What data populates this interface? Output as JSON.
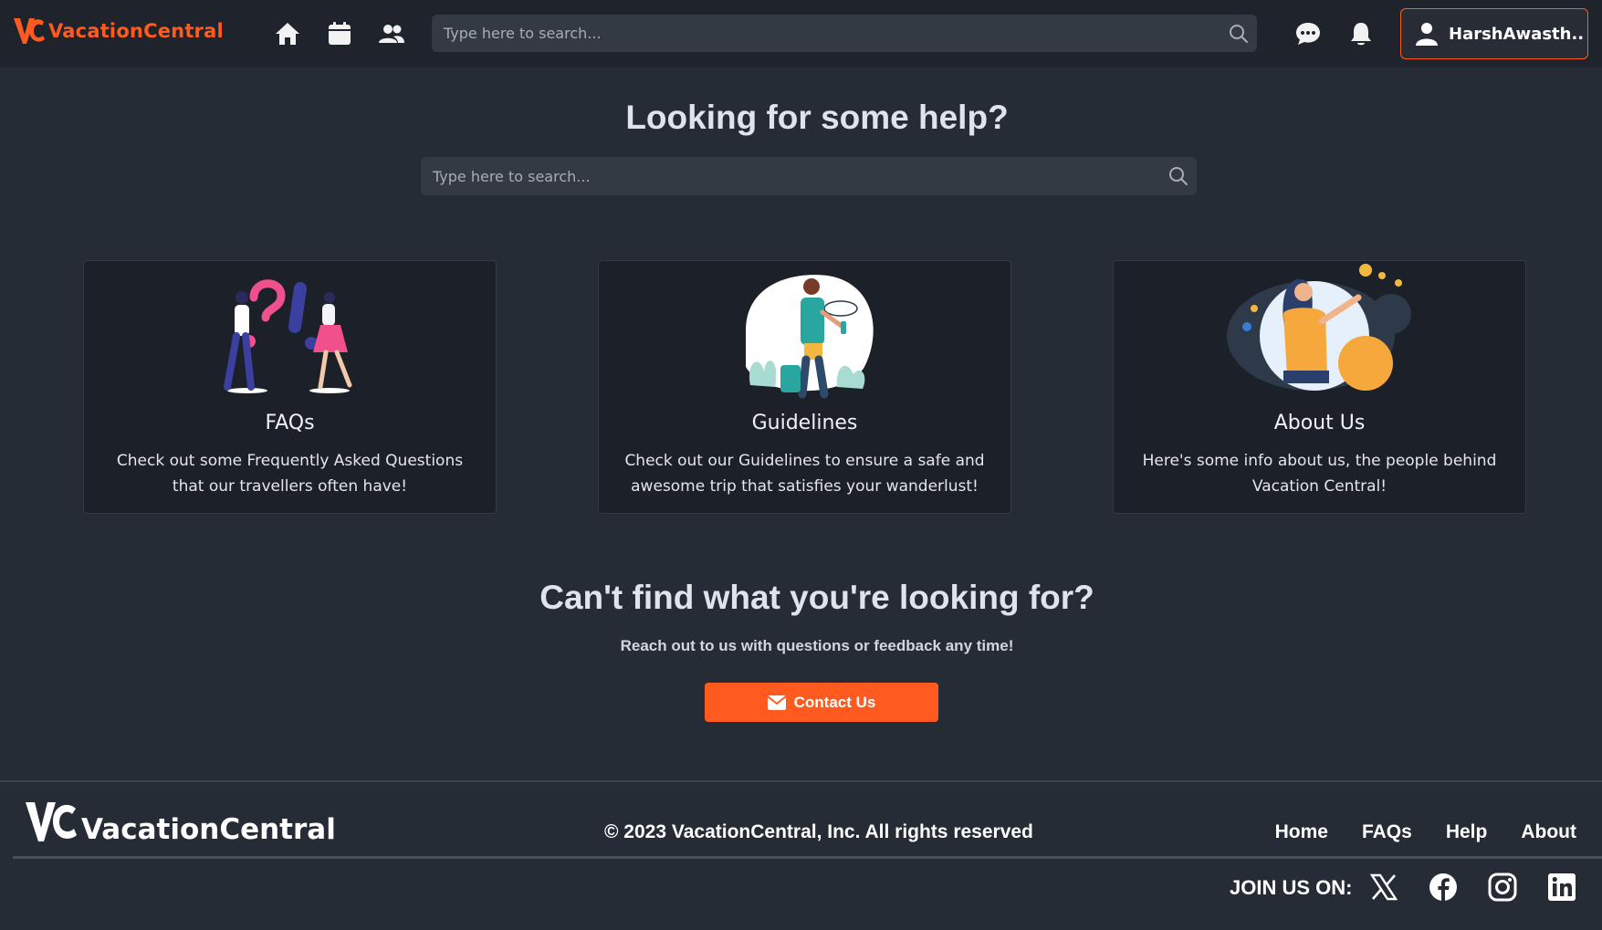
{
  "navbar": {
    "brand": "VacationCentral",
    "search_placeholder": "Type here to search...",
    "user_name": "HarshAwasth...",
    "icons": [
      "home-icon",
      "calendar-icon",
      "users-icon",
      "search-icon",
      "chat-icon",
      "bell-icon",
      "user-icon"
    ]
  },
  "hero": {
    "title": "Looking for some help?",
    "search_placeholder": "Type here to search..."
  },
  "cards": [
    {
      "title": "FAQs",
      "text": "Check out some Frequently Asked Questions that our travellers often have!"
    },
    {
      "title": "Guidelines",
      "text": "Check out our Guidelines to ensure a safe and awesome trip that satisfies your wanderlust!"
    },
    {
      "title": "About Us",
      "text": "Here's some info about us, the people behind Vacation Central!"
    }
  ],
  "cta": {
    "title": "Can't find what you're looking for?",
    "subtitle": "Reach out to us with questions or feedback any time!",
    "button_label": "Contact Us"
  },
  "footer": {
    "brand": "VacationCentral",
    "copyright": "© 2023 VacationCentral, Inc. All rights reserved",
    "links": [
      "Home",
      "FAQs",
      "Help",
      "About"
    ],
    "join_label": "JOIN US ON:",
    "social": [
      "x-icon",
      "facebook-icon",
      "instagram-icon",
      "linkedin-icon"
    ]
  },
  "colors": {
    "accent": "#ff5a1f",
    "background": "#262c36",
    "navbar": "#1f242c",
    "card": "#1c2129"
  }
}
